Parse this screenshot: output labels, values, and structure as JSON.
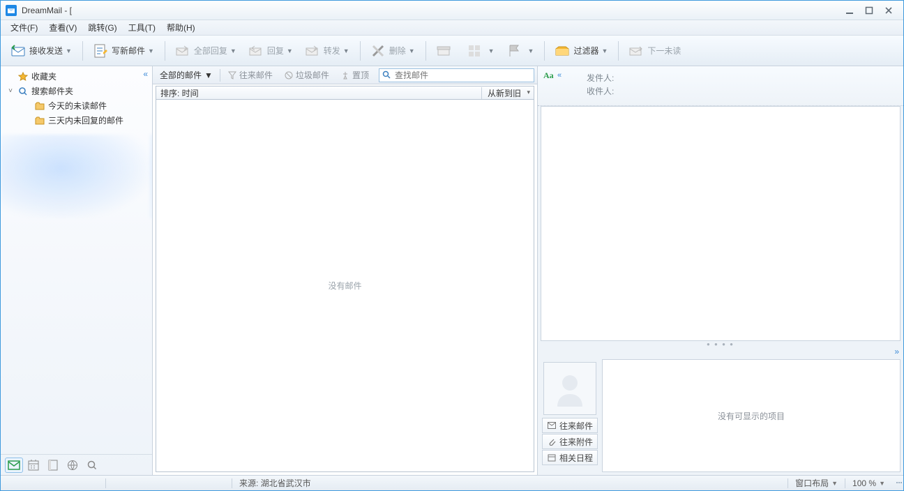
{
  "window": {
    "title": "DreamMail - ["
  },
  "menu": {
    "file": "文件(F)",
    "view": "查看(V)",
    "goto": "跳转(G)",
    "tools": "工具(T)",
    "help": "帮助(H)"
  },
  "toolbar": {
    "receive_send": "接收发送",
    "compose": "写新邮件",
    "reply_all": "全部回复",
    "reply": "回复",
    "forward": "转发",
    "delete": "删除",
    "filter": "过滤器",
    "next_unread": "下一未读"
  },
  "sidebar": {
    "favorites": "收藏夹",
    "search_folder": "搜索邮件夹",
    "items": [
      {
        "label": "今天的未读邮件"
      },
      {
        "label": "三天内未回复的邮件"
      }
    ]
  },
  "filterbar": {
    "all_mail": "全部的邮件",
    "correspondence": "往来邮件",
    "junk": "垃圾邮件",
    "pin": "置顶",
    "search_placeholder": "查找邮件"
  },
  "sortbar": {
    "label": "排序: 时间",
    "order": "从新到旧"
  },
  "list": {
    "empty": "没有邮件"
  },
  "preview": {
    "from_label": "发件人:",
    "to_label": "收件人:",
    "tabs": {
      "mail": "往来邮件",
      "attach": "往来附件",
      "schedule": "相关日程"
    },
    "related_empty": "没有可显示的项目"
  },
  "status": {
    "source": "来源: 湖北省武汉市",
    "layout": "窗口布局",
    "zoom": "100 %"
  }
}
